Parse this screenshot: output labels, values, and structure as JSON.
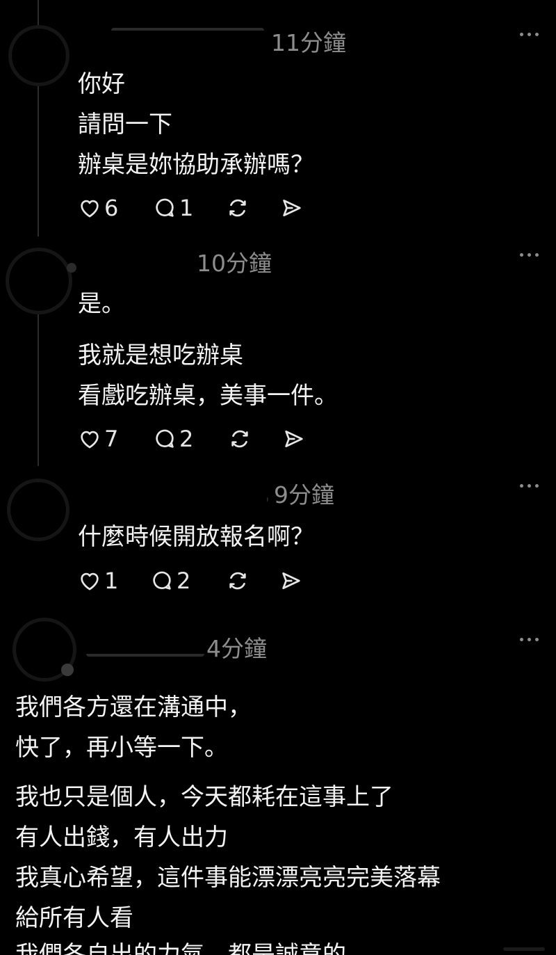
{
  "comments": [
    {
      "time": "11分鐘",
      "lines": [
        "你好",
        "請問一下",
        "辦桌是妳協助承辦嗎？"
      ],
      "likes": "6",
      "replies": "1"
    },
    {
      "time": "10分鐘",
      "lines": [
        "是。",
        "我就是想吃辦桌",
        "看戲吃辦桌，美事一件。"
      ],
      "likes": "7",
      "replies": "2"
    },
    {
      "time": "9分鐘",
      "lines": [
        "什麼時候開放報名啊？"
      ],
      "likes": "1",
      "replies": "2"
    },
    {
      "time": "4分鐘",
      "lines": [
        "我們各方還在溝通中，",
        "快了，再小等一下。",
        "我也只是個人，今天都耗在這事上了",
        "有人出錢，有人出力",
        "我真心希望，這件事能漂漂亮亮完美落幕",
        "給所有人看",
        "我們各自出的力氣，都是誠意的"
      ]
    }
  ],
  "icons": {
    "like": "heart-icon",
    "reply": "comment-bubble-icon",
    "repost": "repost-icon",
    "share": "send-icon",
    "more": "more-options-icon"
  },
  "colors": {
    "background": "#000000",
    "text": "#f3f3f3",
    "muted": "#8d8d8d",
    "thread_line": "#2c2c2c"
  }
}
